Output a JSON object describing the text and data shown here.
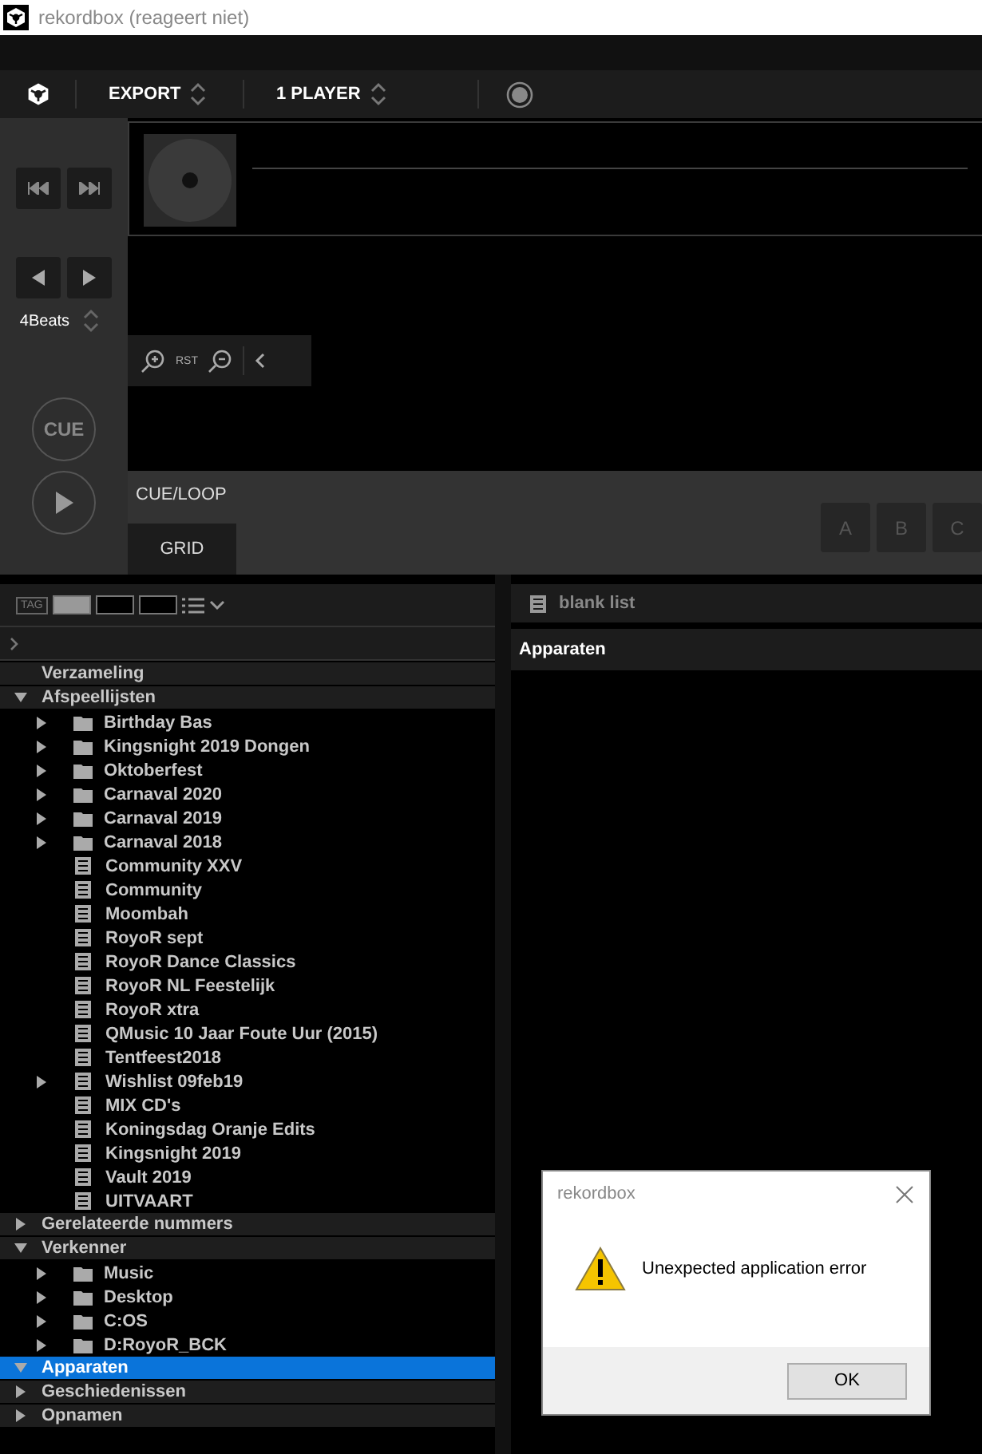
{
  "window": {
    "title": "rekordbox (reageert niet)"
  },
  "toolbar": {
    "mode": "EXPORT",
    "players": "1 PLAYER"
  },
  "deck": {
    "beat_jump": "4Beats",
    "cue_button": "CUE",
    "zoom_reset": "RST",
    "tabs": [
      {
        "label": "CUE/LOOP",
        "selected": true
      },
      {
        "label": "GRID",
        "selected": false
      }
    ],
    "pads": [
      "A",
      "B",
      "C"
    ]
  },
  "browser": {
    "tag_label": "TAG",
    "tree": [
      {
        "label": "Verzameling",
        "selected": false
      },
      {
        "label": "Afspeellijsten",
        "expanded": true,
        "selected": false,
        "children": [
          {
            "label": "Birthday Bas",
            "kind": "folder",
            "expanded": false,
            "selected": false
          },
          {
            "label": "Kingsnight 2019 Dongen",
            "kind": "folder",
            "expanded": false,
            "selected": false
          },
          {
            "label": "Oktoberfest",
            "kind": "folder",
            "expanded": false,
            "selected": false
          },
          {
            "label": "Carnaval 2020",
            "kind": "folder",
            "expanded": false,
            "selected": false
          },
          {
            "label": "Carnaval 2019",
            "kind": "folder",
            "expanded": false,
            "selected": false
          },
          {
            "label": "Carnaval 2018",
            "kind": "folder",
            "expanded": false,
            "selected": false
          },
          {
            "label": "Community XXV",
            "kind": "list",
            "selected": false
          },
          {
            "label": "Community",
            "kind": "list",
            "selected": false
          },
          {
            "label": "Moombah",
            "kind": "list",
            "selected": false
          },
          {
            "label": "RoyoR sept",
            "kind": "list",
            "selected": false
          },
          {
            "label": "RoyoR Dance Classics",
            "kind": "list",
            "selected": false
          },
          {
            "label": "RoyoR NL Feestelijk",
            "kind": "list",
            "selected": false
          },
          {
            "label": "RoyoR xtra",
            "kind": "list",
            "selected": false
          },
          {
            "label": "QMusic 10 Jaar Foute Uur (2015)",
            "kind": "list",
            "selected": false
          },
          {
            "label": "Tentfeest2018",
            "kind": "list",
            "selected": false
          },
          {
            "label": "Wishlist 09feb19",
            "kind": "list",
            "expanded": false,
            "selected": false
          },
          {
            "label": "MIX CD's",
            "kind": "list",
            "selected": false
          },
          {
            "label": "Koningsdag Oranje Edits",
            "kind": "list",
            "selected": false
          },
          {
            "label": "Kingsnight 2019",
            "kind": "list",
            "selected": false
          },
          {
            "label": "Vault 2019",
            "kind": "list",
            "selected": false
          },
          {
            "label": "UITVAART",
            "kind": "list",
            "selected": false
          }
        ]
      },
      {
        "label": "Gerelateerde nummers",
        "expanded": false,
        "selected": false
      },
      {
        "label": "Verkenner",
        "expanded": true,
        "selected": false,
        "children": [
          {
            "label": "Music",
            "kind": "folder",
            "expanded": false,
            "selected": false
          },
          {
            "label": "Desktop",
            "kind": "folder",
            "expanded": false,
            "selected": false
          },
          {
            "label": "C:OS",
            "kind": "folder",
            "expanded": false,
            "selected": false
          },
          {
            "label": "D:RoyoR_BCK",
            "kind": "folder",
            "expanded": false,
            "selected": false
          }
        ]
      },
      {
        "label": "Apparaten",
        "expanded": true,
        "selected": true
      },
      {
        "label": "Geschiedenissen",
        "expanded": false,
        "selected": false
      },
      {
        "label": "Opnamen",
        "expanded": false,
        "selected": false
      }
    ]
  },
  "list": {
    "title": "blank list",
    "header": "Apparaten"
  },
  "dialog": {
    "title": "rekordbox",
    "message": "Unexpected application error",
    "button": "OK"
  }
}
